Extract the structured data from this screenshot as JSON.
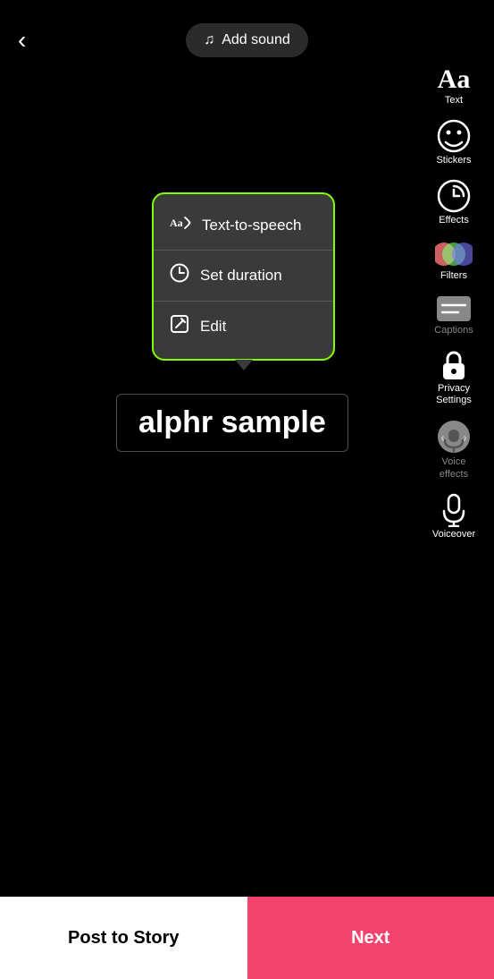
{
  "header": {
    "back_label": "‹",
    "add_sound_icon": "♫",
    "add_sound_label": "Add sound"
  },
  "toolbar": {
    "items": [
      {
        "id": "text",
        "label": "Text",
        "icon": "Aa",
        "disabled": false
      },
      {
        "id": "stickers",
        "label": "Stickers",
        "icon": "sticker",
        "disabled": false
      },
      {
        "id": "effects",
        "label": "Effects",
        "icon": "effects",
        "disabled": false
      },
      {
        "id": "filters",
        "label": "Filters",
        "icon": "filters",
        "disabled": false
      },
      {
        "id": "captions",
        "label": "Captions",
        "icon": "captions",
        "disabled": true
      },
      {
        "id": "privacy",
        "label": "Privacy\nSettings",
        "icon": "lock",
        "disabled": false
      },
      {
        "id": "voice-effects",
        "label": "Voice\neffects",
        "icon": "voice",
        "disabled": true
      },
      {
        "id": "voiceover",
        "label": "Voiceover",
        "icon": "mic",
        "disabled": false
      }
    ]
  },
  "context_menu": {
    "items": [
      {
        "id": "text-to-speech",
        "label": "Text-to-speech",
        "icon": "🔤"
      },
      {
        "id": "set-duration",
        "label": "Set duration",
        "icon": "⏱"
      },
      {
        "id": "edit",
        "label": "Edit",
        "icon": "✏️"
      }
    ]
  },
  "text_overlay": {
    "content": "alphr sample"
  },
  "bottom": {
    "post_story_label": "Post to Story",
    "next_label": "Next"
  }
}
